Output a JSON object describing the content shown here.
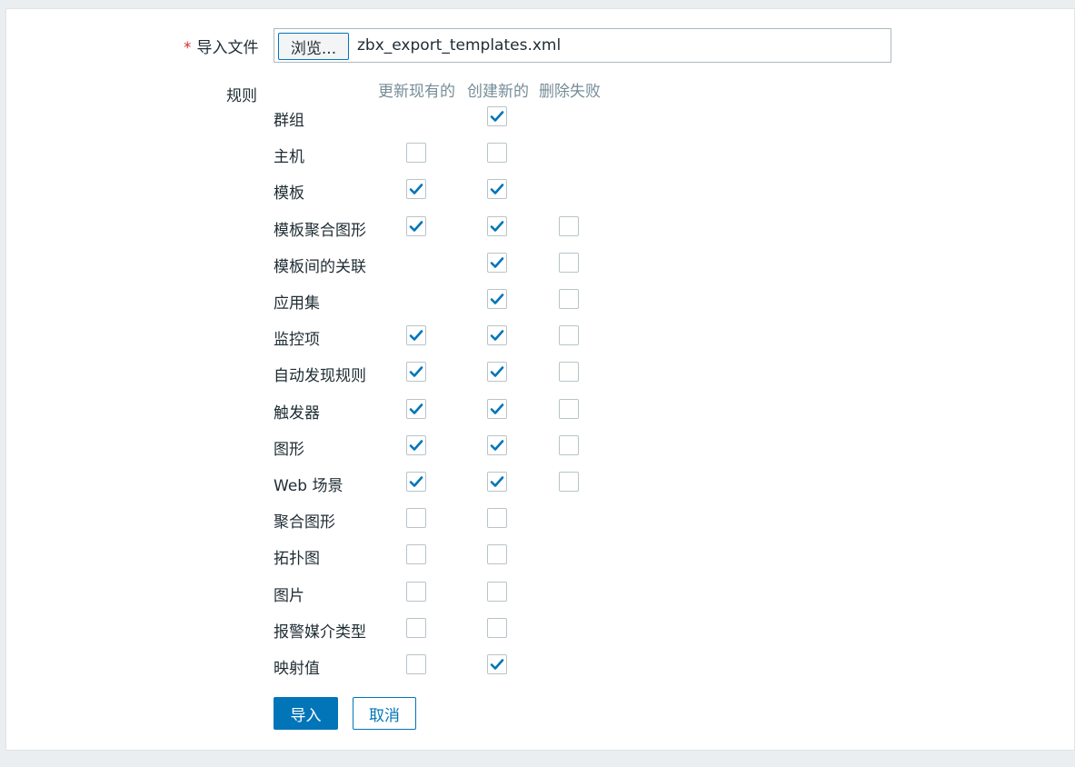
{
  "form": {
    "import_file_label": "导入文件",
    "required_mark": "*",
    "browse_button": "浏览...",
    "file_name": "zbx_export_templates.xml",
    "rules_label": "规则"
  },
  "columns": {
    "update_existing": "更新现有的",
    "create_new": "创建新的",
    "delete_missing": "删除失败"
  },
  "rules": [
    {
      "label": "群组",
      "update": null,
      "create": true,
      "delete": null
    },
    {
      "label": "主机",
      "update": false,
      "create": false,
      "delete": null
    },
    {
      "label": "模板",
      "update": true,
      "create": true,
      "delete": null
    },
    {
      "label": "模板聚合图形",
      "update": true,
      "create": true,
      "delete": false
    },
    {
      "label": "模板间的关联",
      "update": null,
      "create": true,
      "delete": false
    },
    {
      "label": "应用集",
      "update": null,
      "create": true,
      "delete": false
    },
    {
      "label": "监控项",
      "update": true,
      "create": true,
      "delete": false
    },
    {
      "label": "自动发现规则",
      "update": true,
      "create": true,
      "delete": false
    },
    {
      "label": "触发器",
      "update": true,
      "create": true,
      "delete": false
    },
    {
      "label": "图形",
      "update": true,
      "create": true,
      "delete": false
    },
    {
      "label": "Web 场景",
      "update": true,
      "create": true,
      "delete": false
    },
    {
      "label": "聚合图形",
      "update": false,
      "create": false,
      "delete": null
    },
    {
      "label": "拓扑图",
      "update": false,
      "create": false,
      "delete": null
    },
    {
      "label": "图片",
      "update": false,
      "create": false,
      "delete": null
    },
    {
      "label": "报警媒介类型",
      "update": false,
      "create": false,
      "delete": null
    },
    {
      "label": "映射值",
      "update": false,
      "create": true,
      "delete": null
    }
  ],
  "actions": {
    "import_button": "导入",
    "cancel_button": "取消"
  },
  "colors": {
    "accent": "#0275b8",
    "required": "#d32f2f",
    "muted_header": "#768d99"
  }
}
